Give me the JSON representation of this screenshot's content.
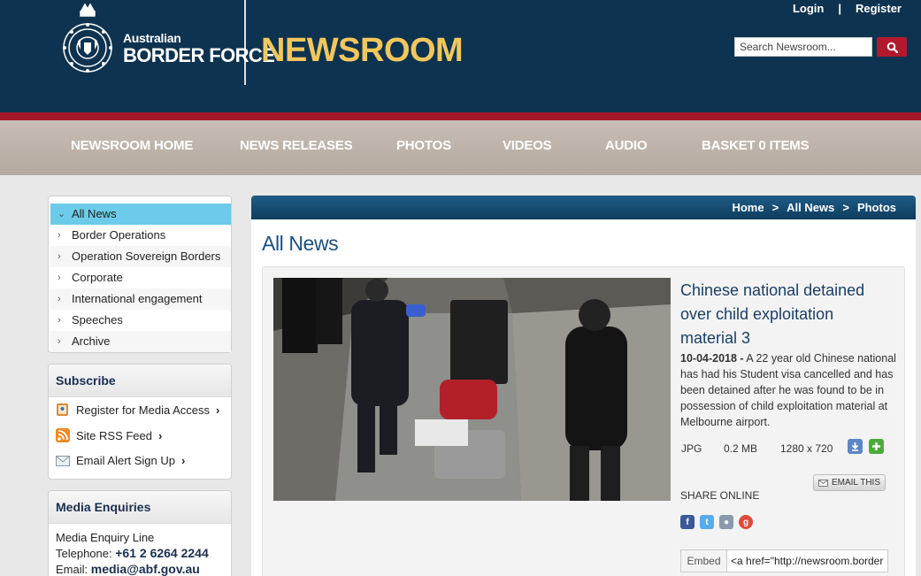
{
  "header": {
    "logo_line1": "Australian",
    "logo_line2": "BORDER FORCE",
    "site_title": "NEWSROOM",
    "login_label": "Login",
    "separator": "|",
    "register_label": "Register",
    "search_placeholder": "Search Newsroom..."
  },
  "nav": {
    "items": [
      {
        "label": "NEWSROOM HOME"
      },
      {
        "label": "NEWS RELEASES"
      },
      {
        "label": "PHOTOS"
      },
      {
        "label": "VIDEOS"
      },
      {
        "label": "AUDIO"
      },
      {
        "label": "BASKET 0 ITEMS"
      }
    ]
  },
  "sidebar": {
    "categories": [
      {
        "label": "All News",
        "active": true
      },
      {
        "label": "Border Operations"
      },
      {
        "label": "Operation Sovereign Borders"
      },
      {
        "label": "Corporate"
      },
      {
        "label": "International engagement"
      },
      {
        "label": "Speeches"
      },
      {
        "label": "Archive"
      }
    ],
    "subscribe": {
      "heading": "Subscribe",
      "items": [
        {
          "label": "Register for Media Access",
          "icon": "register-icon"
        },
        {
          "label": "Site RSS Feed",
          "icon": "rss-icon"
        },
        {
          "label": "Email Alert Sign Up",
          "icon": "email-icon"
        }
      ]
    },
    "media": {
      "heading": "Media Enquiries",
      "line_label": "Media Enquiry Line",
      "telephone_label": "Telephone:",
      "telephone_value": "+61 2 6264 2244",
      "email_label": "Email:",
      "email_value": "media@abf.gov.au"
    }
  },
  "breadcrumb": {
    "items": [
      "Home",
      "All News",
      "Photos"
    ],
    "separator": ">"
  },
  "main": {
    "section_title": "All News",
    "item": {
      "title": "Chinese national detained over child exploitation material 3",
      "date": "10-04-2018 -",
      "description": " A 22 year old Chinese national has had his Student visa cancelled and has been detained after he was found to be in possession of child exploitation material at Melbourne airport.",
      "format": "JPG",
      "size": "0.2 MB",
      "dimensions": "1280 x 720",
      "share_label": "SHARE ONLINE",
      "email_this_label": "EMAIL THIS",
      "embed_label": "Embed",
      "embed_value": "<a href=\"http://newsroom.border"
    }
  },
  "colors": {
    "header_bg": "#0e3350",
    "accent_red": "#a3192a",
    "title_gold": "#f2c75c",
    "nav_bg": "#b9aea4",
    "active_cat": "#6ccbe8",
    "link_blue": "#1a3f66"
  }
}
